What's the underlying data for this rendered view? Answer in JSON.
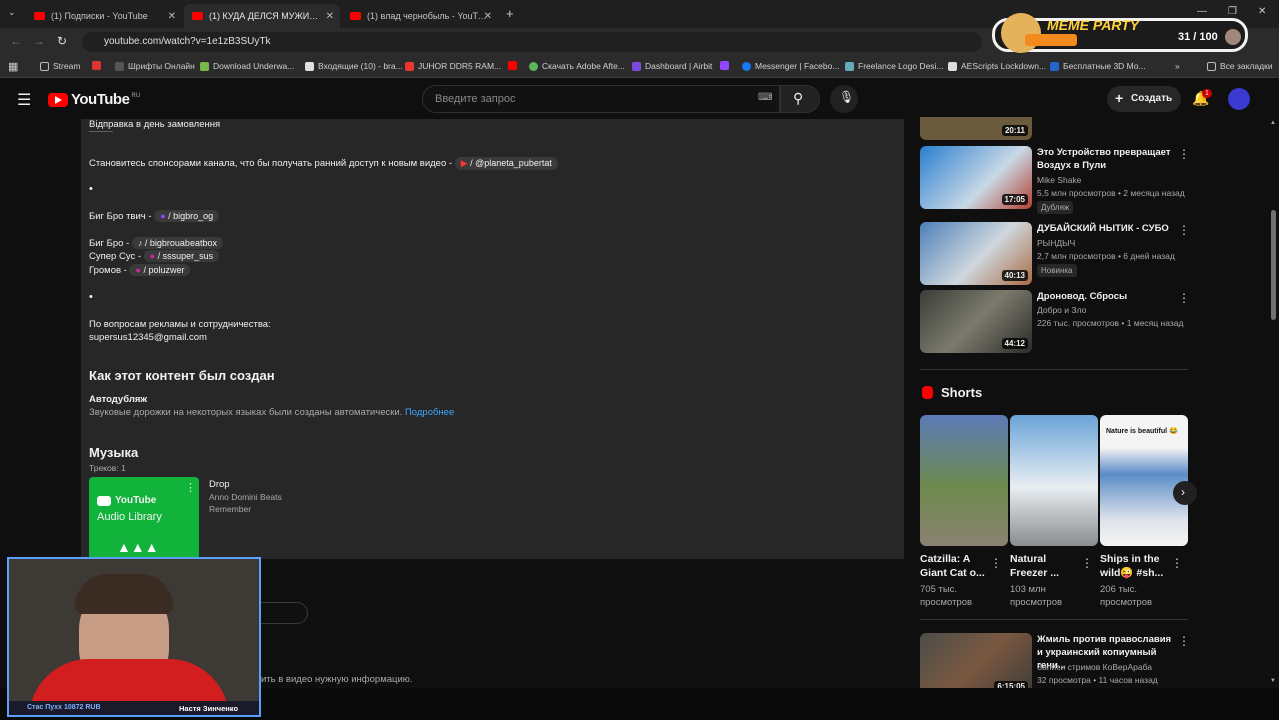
{
  "tabs": [
    {
      "title": "(1) Подписки - YouTube"
    },
    {
      "title": "(1) КУДА ДЕЛСЯ МУЖИК из ТРОТУАРА"
    },
    {
      "title": "(1) влад чернобыль - YouTube"
    }
  ],
  "address": {
    "url": "youtube.com/watch?v=1e1zB3SUyTk"
  },
  "bookmarks": [
    "Stream",
    "Шрифты Онлайн",
    "Download Underwa...",
    "Входящие (10) - bra...",
    "JUHOR DDR5 RAM...",
    "",
    "Скачать Adobe Afte...",
    "Dashboard | Airbit",
    "Messenger | Facebo...",
    "Freelance Logo Desi...",
    "AEScripts Lockdown...",
    "Бесплатные 3D Mo...",
    "Все закладки"
  ],
  "youtube": {
    "logo": "YouTube",
    "region": "RU",
    "search_placeholder": "Введите запрос",
    "create_label": "Создать",
    "notif_count": "1"
  },
  "description": {
    "line1": "Відправка в день замовлення",
    "line1b": "————",
    "sponsor": "Становитесь спонсорами канала, что бы получать ранний доступ к новым видео -",
    "sponsor_chip": "/ @planeta_pubertat",
    "bullet": "•",
    "twitch_label": "Биг Бро твич -",
    "twitch_chip": "/ bigbro_og",
    "bigbro_label": "Биг Бро -",
    "bigbro_chip": "/ bigbrouabeatbox",
    "sus_label": "Супер Сус -",
    "sus_chip": "/ sssuper_sus",
    "gromov_label": "Громов -",
    "gromov_chip": "/ poluzwer",
    "ads_label": "По вопросам рекламы и сотрудничества:",
    "email": "supersus12345@gmail.com",
    "how_title": "Как этот контент был создан",
    "autodub_title": "Автодубляж",
    "autodub_text": "Звуковые дорожки на некоторых языках были созданы автоматически.",
    "more_link": "Подробнее",
    "music_title": "Музыка",
    "tracks": "Треков: 1",
    "audio_lib1": "YouTube",
    "audio_lib2": "Audio Library",
    "song": "Drop",
    "artist": "Anno Domini Beats",
    "album": "Remember",
    "footer_text": "ить в видео нужную информацию."
  },
  "sidebar": {
    "top_duration": "20:11",
    "videos": [
      {
        "title": "Это Устройство превращает Воздух в Пули",
        "channel": "Mike Shake",
        "meta": "5,5 млн просмотров • 2 месяца назад",
        "badge": "Дубляж",
        "duration": "17:05"
      },
      {
        "title": "ДУБАЙСКИЙ НЫТИК - СУБО",
        "channel": "РЫНДЫЧ",
        "meta": "2,7 млн просмотров • 6 дней назад",
        "badge": "Новинка",
        "duration": "40:13"
      },
      {
        "title": "Дроновод. Сбросы",
        "channel": "Добро и Зло",
        "meta": "226 тыс. просмотров • 1 месяц назад",
        "badge": "",
        "duration": "44:12"
      }
    ],
    "shorts_title": "Shorts",
    "shorts": [
      {
        "title": "Catzilla: A Giant Cat o...",
        "views": "705 тыс. просмотров"
      },
      {
        "title": "Natural Freezer ...",
        "views": "103 млн просмотров"
      },
      {
        "title": "Ships in the wild😜 #sh...",
        "views": "206 тыс. просмотров",
        "thumb_text": "Nature is beautiful 😂"
      }
    ],
    "last": {
      "title": "Жмиль против православия и украинский копиумный гени...",
      "channel": "Записи стримов КоВерАраба",
      "meta": "32 просмотра • 11 часов назад",
      "duration": "6:15:05"
    }
  },
  "overlay": {
    "meme_title": "MEME PARTY",
    "meme_count": "31 / 100",
    "cam_left": "Стас Пухх 10872 RUB",
    "cam_right": "Настя Зинченко"
  },
  "colors": {
    "accent": "#3ea6ff",
    "red": "#ff0000"
  }
}
